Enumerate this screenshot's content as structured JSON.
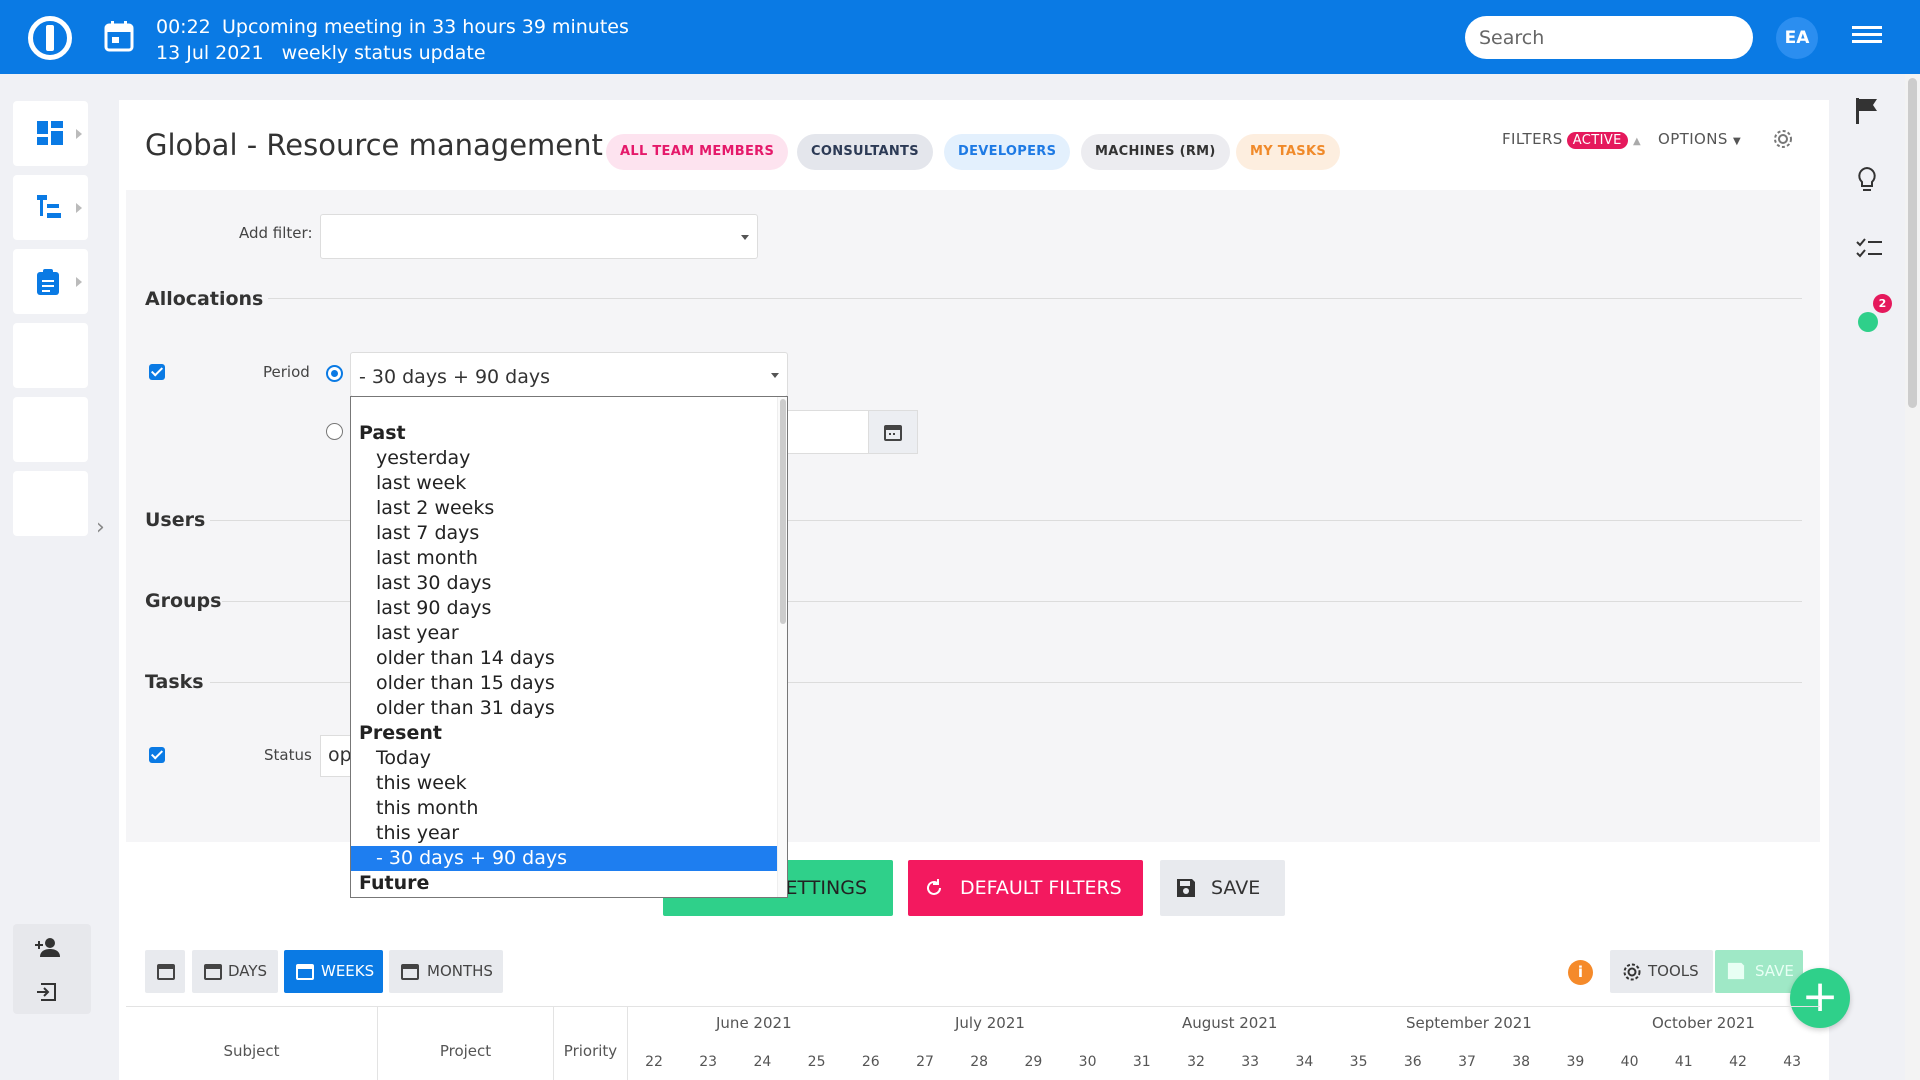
{
  "topbar": {
    "time": "00:22",
    "meeting": "Upcoming meeting in 33 hours 39 minutes",
    "date": "13 Jul 2021",
    "meeting_name": "weekly status update",
    "search_placeholder": "Search",
    "avatar": "EA"
  },
  "header": {
    "title": "Global - Resource management",
    "chips": [
      "ALL TEAM MEMBERS",
      "CONSULTANTS",
      "DEVELOPERS",
      "MACHINES (RM)",
      "MY TASKS"
    ],
    "filters": "FILTERS",
    "active": "ACTIVE",
    "options": "OPTIONS"
  },
  "filters": {
    "add_filter": "Add filter:",
    "allocations": "Allocations",
    "period_label": "Period",
    "period_value": "- 30 days + 90 days",
    "users": "Users",
    "groups": "Groups",
    "tasks": "Tasks",
    "status_label": "Status",
    "status_value": "op"
  },
  "dropdown": {
    "past": "Past",
    "past_items": [
      "yesterday",
      "last week",
      "last 2 weeks",
      "last 7 days",
      "last month",
      "last 30 days",
      "last 90 days",
      "last year",
      "older than 14 days",
      "older than 15 days",
      "older than 31 days"
    ],
    "present": "Present",
    "present_items": [
      "Today",
      "this week",
      "this month",
      "this year",
      "- 30 days + 90 days"
    ],
    "future": "Future"
  },
  "buttons": {
    "settings": "ETTINGS",
    "default_filters": "DEFAULT FILTERS",
    "save": "SAVE"
  },
  "toolbar": {
    "days": "DAYS",
    "weeks": "WEEKS",
    "months": "MONTHS",
    "tools": "TOOLS",
    "save": "SAVE",
    "info": "i"
  },
  "gantt": {
    "columns": [
      "Subject",
      "Project",
      "Priority"
    ],
    "months": [
      "June 2021",
      "July 2021",
      "August 2021",
      "September 2021",
      "October 2021"
    ],
    "weeks": [
      "22",
      "23",
      "24",
      "25",
      "26",
      "27",
      "28",
      "29",
      "30",
      "31",
      "32",
      "33",
      "34",
      "35",
      "36",
      "37",
      "38",
      "39",
      "40",
      "41",
      "42",
      "43"
    ]
  },
  "notifications": {
    "count": "2"
  },
  "colors": {
    "brand": "#0a7ae4",
    "accent_green": "#2fd08a",
    "accent_pink": "#f3195f"
  }
}
